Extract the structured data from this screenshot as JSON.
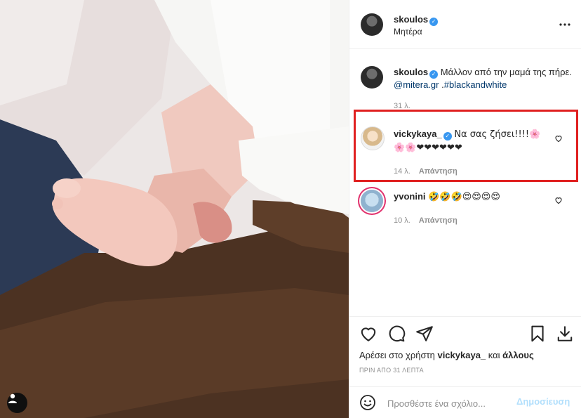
{
  "post": {
    "author": "skoulos",
    "location": "Μητέρα",
    "more_icon": "more-horizontal-icon"
  },
  "caption": {
    "username": "skoulos",
    "text_part1": "Μάλλον από την μαμά της πήρε. ",
    "mention": "@mitera.gr",
    "text_part2": " .",
    "hashtag": "#blackandwhite",
    "time": "31 λ."
  },
  "comments": [
    {
      "username": "vickykaya_",
      "verified": true,
      "text": "Να σας ζήσει!!!!🌸🌸🌸❤❤❤❤❤❤",
      "time": "14 λ.",
      "reply_label": "Απάντηση",
      "highlighted": true
    },
    {
      "username": "yvonini",
      "verified": false,
      "text": "🤣🤣🤣😍😍😍😍",
      "time": "10 λ.",
      "reply_label": "Απάντηση",
      "highlighted": false
    }
  ],
  "likes": {
    "prefix": "Αρέσει στο χρήστη",
    "liker": "vickykaya_",
    "connector": "και",
    "others": "άλλους"
  },
  "timestamp": "ΠΡΙΝ ΑΠΟ 31 ΛΕΠΤΑ",
  "add_comment": {
    "placeholder": "Προσθέστε ένα σχόλιο...",
    "post_label": "Δημοσίευση",
    "emoji_icon": "smiley-icon"
  },
  "colors": {
    "highlight_border": "#e02020",
    "verified_badge": "#3897f0",
    "link": "#00376b",
    "post_button_disabled": "#b2dffc",
    "muted_text": "#8e8e8e"
  }
}
